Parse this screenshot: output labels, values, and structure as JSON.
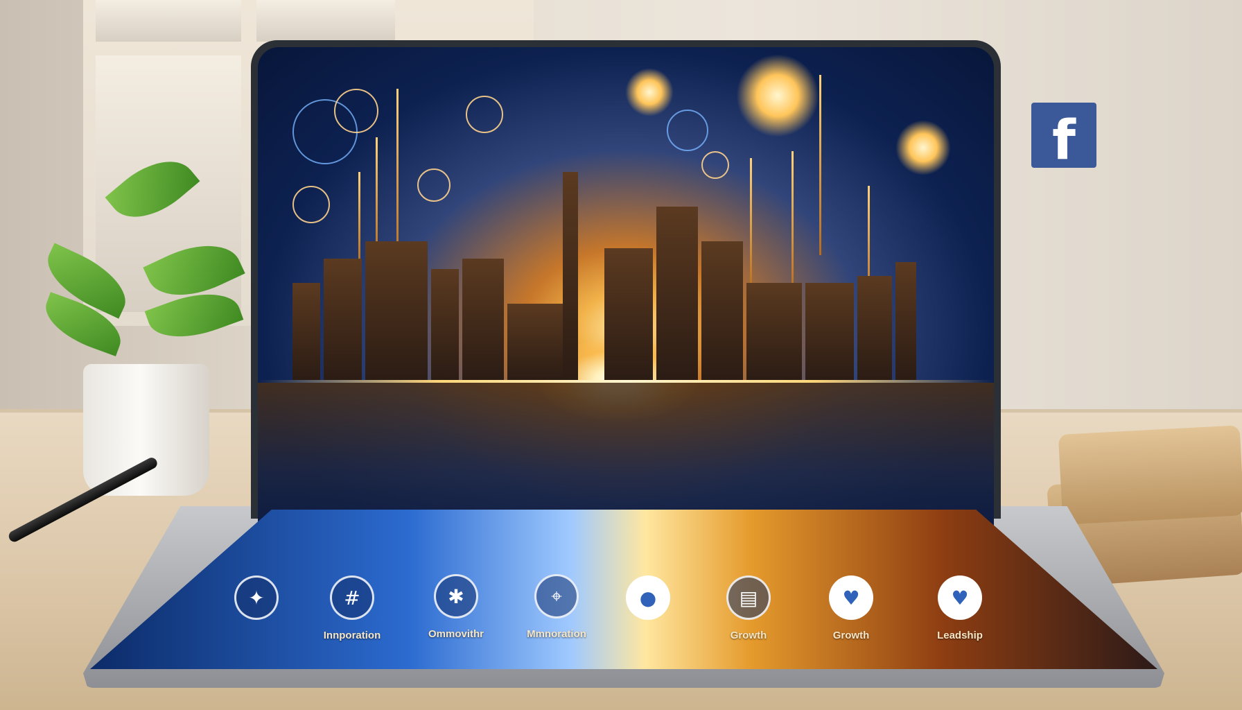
{
  "brand": {
    "facebook_glyph": "f",
    "facebook_color": "#3b5998"
  },
  "screen_icons": [
    {
      "name": "innovation-icon",
      "glyph": "✦",
      "label": ""
    },
    {
      "name": "build-icon",
      "glyph": "#",
      "label": "Innporation"
    },
    {
      "name": "network-icon",
      "glyph": "✱",
      "label": "Ommovithr"
    },
    {
      "name": "location-icon",
      "glyph": "⌖",
      "label": "Mmnoration"
    },
    {
      "name": "pin-icon",
      "glyph": "●",
      "label": ""
    },
    {
      "name": "chart-icon",
      "glyph": "▤",
      "label": "Growth"
    },
    {
      "name": "heart-pin-icon",
      "glyph": "♥",
      "label": "Growth"
    },
    {
      "name": "heart-icon",
      "glyph": "♥",
      "label": "Leadship"
    }
  ],
  "colors": {
    "night_blue": "#0d2150",
    "gold": "#f2b34a",
    "electric_blue": "#2c6bd0"
  }
}
